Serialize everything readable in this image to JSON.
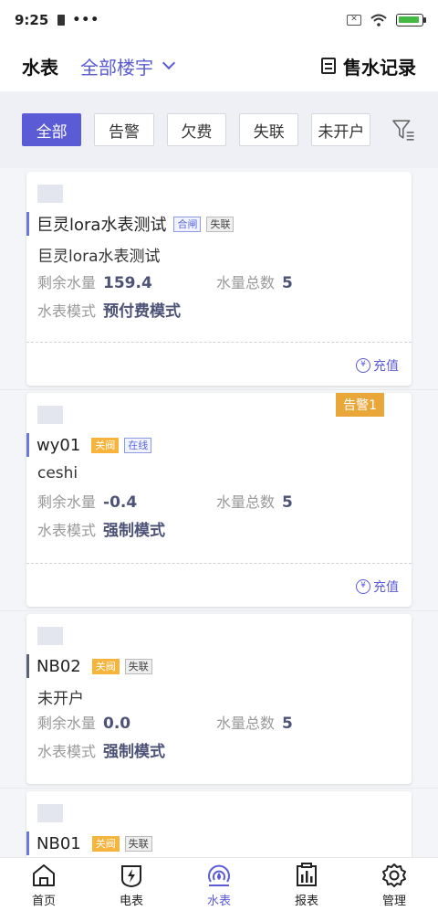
{
  "status_bar": {
    "time": "9:25",
    "dots": "•••"
  },
  "header": {
    "title": "水表",
    "building_select": "全部楼宇",
    "record_label": "售水记录"
  },
  "filters": {
    "items": [
      {
        "label": "全部",
        "active": true
      },
      {
        "label": "告警",
        "active": false
      },
      {
        "label": "欠费",
        "active": false
      },
      {
        "label": "失联",
        "active": false
      },
      {
        "label": "未开户",
        "active": false
      }
    ]
  },
  "meters": [
    {
      "name": "巨灵lora水表测试",
      "tags": [
        "合闸",
        "失联"
      ],
      "subtitle": "巨灵lora水表测试",
      "remaining_label": "剩余水量",
      "remaining": "159.4",
      "total_label": "水量总数",
      "total": "5",
      "mode_label": "水表模式",
      "mode": "预付费模式",
      "recharge": "充值"
    },
    {
      "name": "wy01",
      "tags": [
        "关阀",
        "在线"
      ],
      "alarm": "告警1",
      "subtitle": "ceshi",
      "remaining_label": "剩余水量",
      "remaining": "-0.4",
      "total_label": "水量总数",
      "total": "5",
      "mode_label": "水表模式",
      "mode": "强制模式",
      "recharge": "充值"
    },
    {
      "name": "NB02",
      "tags": [
        "关阀",
        "失联"
      ],
      "subtitle": "未开户",
      "remaining_label": "剩余水量",
      "remaining": "0.0",
      "total_label": "水量总数",
      "total": "5",
      "mode_label": "水表模式",
      "mode": "强制模式"
    },
    {
      "name": "NB01",
      "tags": [
        "关阀",
        "失联"
      ]
    }
  ],
  "yen_symbol": "¥",
  "bottom_nav": [
    {
      "label": "首页",
      "icon": "home-icon"
    },
    {
      "label": "电表",
      "icon": "electric-meter-icon"
    },
    {
      "label": "水表",
      "icon": "water-meter-icon",
      "active": true
    },
    {
      "label": "报表",
      "icon": "report-icon"
    },
    {
      "label": "管理",
      "icon": "settings-icon"
    }
  ],
  "colors": {
    "accent": "#5a5bd5",
    "alarm": "#e9a639",
    "tag_orange": "#f6b43c"
  }
}
